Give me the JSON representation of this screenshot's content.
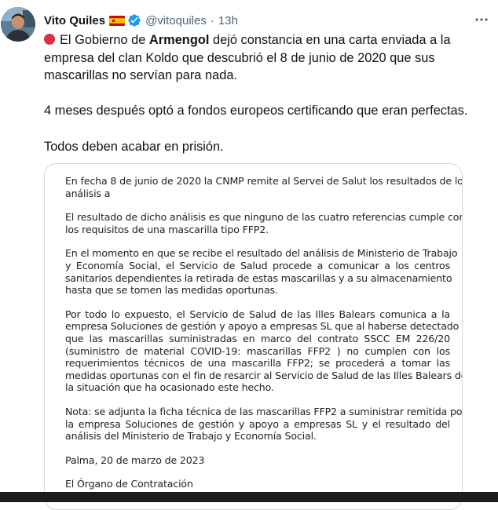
{
  "author": {
    "name": "Vito Quiles",
    "handle": "@vitoquiles",
    "separator": "·",
    "time": "13h",
    "flag_icon": "spain-flag-icon",
    "verified_icon": "verified-badge-icon",
    "verified_color": "#1d9bf0"
  },
  "tweet": {
    "marker_icon": "red-circle-icon",
    "marker_color": "#dd2e44",
    "p1_before": "El Gobierno de ",
    "p1_bold": "Armengol",
    "p1_after": " dejó constancia en una carta enviada a la empresa del clan Koldo que descubrió el 8 de junio de 2020 que sus mascarillas no servían para nada.",
    "p2": "4 meses después optó a fondos europeos certificando que eran perfectas.",
    "p3": "Todos deben acabar en prisión."
  },
  "document": {
    "lines": [
      "En fecha 8 de junio de 2020 la CNMP remite al Servei de Salut los resultados de los",
      "análisis a",
      "El resultado de dicho análisis es que ninguno de las cuatro referencias cumple con",
      "los requisitos de una mascarilla tipo FFP2.",
      "En el momento en que se recibe el resultado del análisis de Ministerio de Trabajo",
      "y Economía Social, el Servicio de Salud procede a comunicar a los centros",
      "sanitarios dependientes la retirada de estas mascarillas y a su almacenamiento",
      "hasta que se tomen las medidas oportunas.",
      "Por todo lo expuesto, el Servicio de Salud de las Illes Balears comunica a la",
      "empresa Soluciones de gestión y apoyo a empresas SL que al haberse detectado",
      "que las mascarillas suministradas en marco del contrato SSCC EM 226/20",
      "(suministro de material COVID-19: mascarillas FFP2 ) no cumplen con los",
      "requerimientos técnicos de una mascarilla FFP2; se procederá a tomar las",
      "medidas oportunas con el fin de resarcir al Servicio de Salud de las Illes Balears de",
      "la situación que ha ocasionado este hecho.",
      "Nota: se adjunta la ficha técnica de las mascarillas FFP2 a suministrar remitida por",
      "la empresa Soluciones de gestión y apoyo a empresas SL y el resultado del",
      "análisis del Ministerio de Trabajo y Economía Social.",
      "Palma, 20 de marzo de 2023",
      "El Órgano de Contratación"
    ]
  },
  "actions": {
    "more_icon": "more-options-icon"
  }
}
